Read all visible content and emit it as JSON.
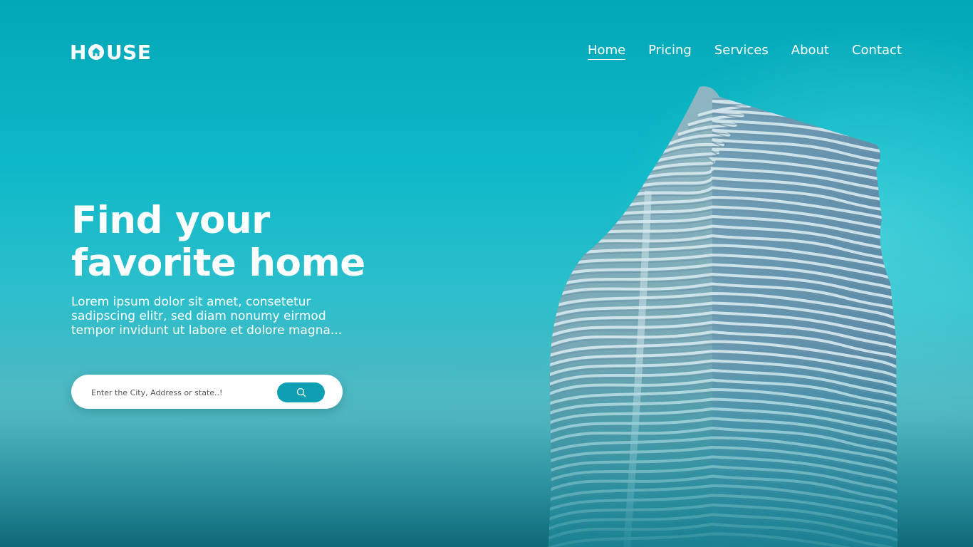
{
  "brand": {
    "logo_prefix": "H",
    "logo_suffix": "USE",
    "logo_full": "HOUSE",
    "accent": "#0e9fb2",
    "background_top": "#03a7b7",
    "background_mid": "#2fbfcc"
  },
  "nav": {
    "items": [
      {
        "label": "Home",
        "active": true
      },
      {
        "label": "Pricing",
        "active": false
      },
      {
        "label": "Services",
        "active": false
      },
      {
        "label": "About",
        "active": false
      },
      {
        "label": "Contact",
        "active": false
      }
    ]
  },
  "hero": {
    "title_line1": "Find your",
    "title_line2": "favorite home",
    "description": "Lorem ipsum dolor sit amet, consetetur sadipscing elitr, sed diam nonumy eirmod tempor invidunt ut labore et dolore magna...",
    "search_placeholder": "Enter the City, Address or state..!",
    "search_icon": "search-icon"
  },
  "image": {
    "subject": "building-photo"
  }
}
